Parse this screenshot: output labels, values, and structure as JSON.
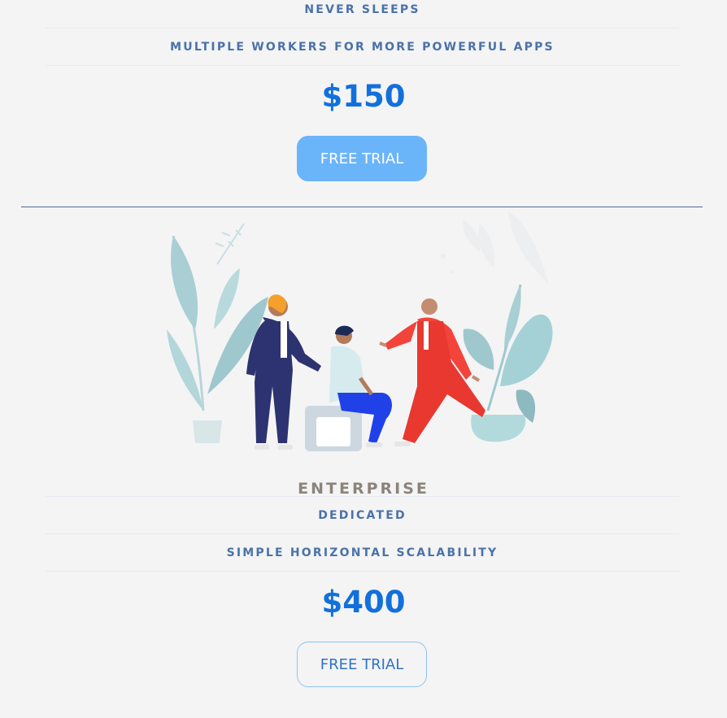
{
  "top_plan": {
    "features": [
      "NEVER SLEEPS",
      "MULTIPLE WORKERS FOR MORE POWERFUL APPS"
    ],
    "price": "$150",
    "cta_label": "FREE TRIAL"
  },
  "enterprise_plan": {
    "name": "ENTERPRISE",
    "features": [
      "DEDICATED",
      "SIMPLE HORIZONTAL SCALABILITY"
    ],
    "price": "$400",
    "cta_label": "FREE TRIAL"
  },
  "colors": {
    "background": "#f4f4f5",
    "price": "#1270dc",
    "feature_text": "#4a72a8",
    "cta_filled": "#6ab4fa",
    "cta_outline_border": "#8fc2f5"
  },
  "icons": {
    "illustration": "team-meeting-illustration"
  }
}
